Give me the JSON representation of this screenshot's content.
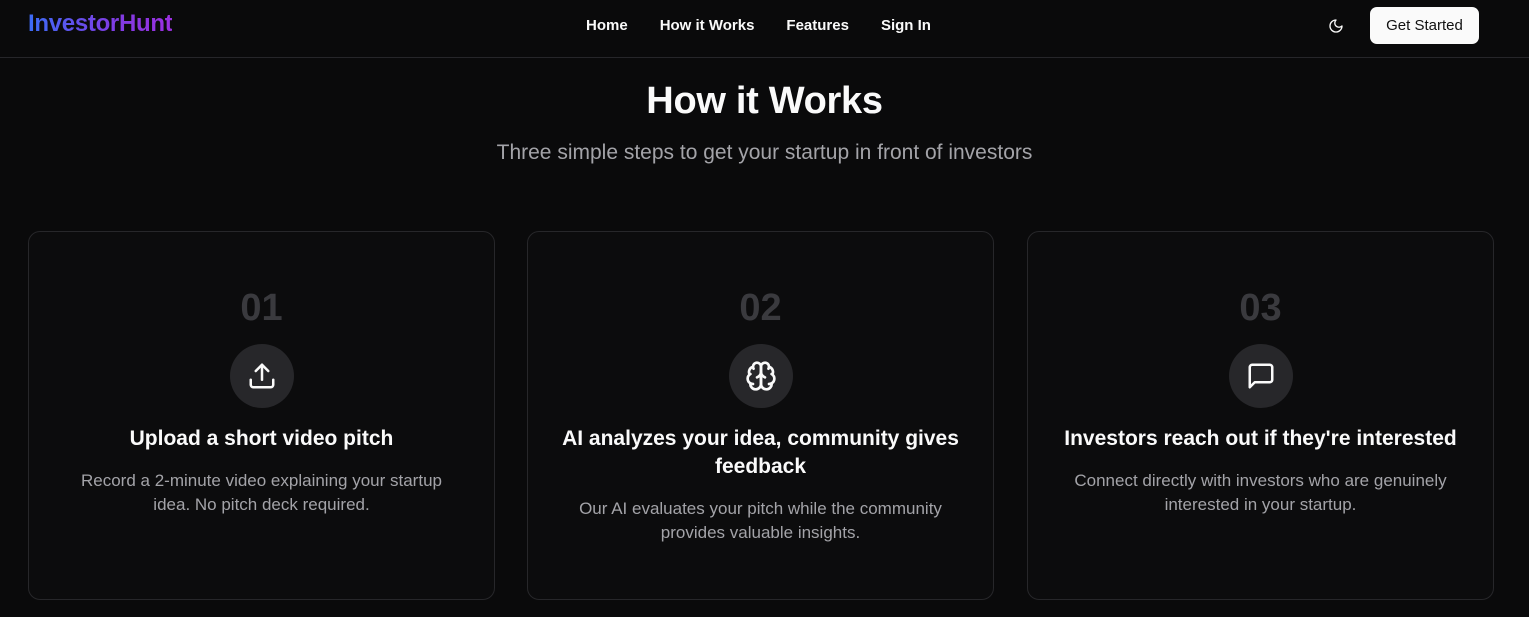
{
  "header": {
    "logo": "InvestorHunt",
    "nav": [
      {
        "label": "Home"
      },
      {
        "label": "How it Works"
      },
      {
        "label": "Features"
      },
      {
        "label": "Sign In"
      }
    ],
    "theme_icon": "moon-icon",
    "cta_label": "Get Started"
  },
  "section": {
    "title": "How it Works",
    "subtitle": "Three simple steps to get your startup in front of investors"
  },
  "steps": [
    {
      "number": "01",
      "icon": "upload-icon",
      "title": "Upload a short video pitch",
      "description": "Record a 2-minute video explaining your startup idea. No pitch deck required."
    },
    {
      "number": "02",
      "icon": "brain-icon",
      "title": "AI analyzes your idea, community gives feedback",
      "description": "Our AI evaluates your pitch while the community provides valuable insights."
    },
    {
      "number": "03",
      "icon": "message-square-icon",
      "title": "Investors reach out if they're interested",
      "description": "Connect directly with investors who are genuinely interested in your startup."
    }
  ],
  "colors": {
    "background": "#0a0a0b",
    "card_border": "#27272a",
    "muted_text": "#a3a3a8",
    "step_number": "#3a3a3e",
    "logo_gradient_start": "#3b6cf6",
    "logo_gradient_end": "#9b2fe0"
  }
}
